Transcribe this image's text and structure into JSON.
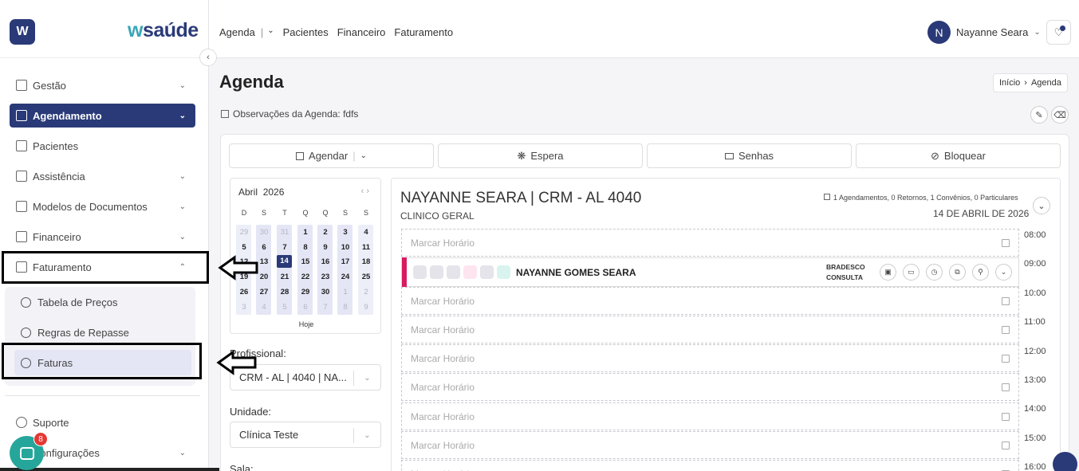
{
  "app": {
    "brand_prefix": "w",
    "brand_rest": "saúde",
    "logo_letter": "W"
  },
  "sidebar": {
    "items": [
      {
        "label": "Gestão"
      },
      {
        "label": "Agendamento"
      },
      {
        "label": "Pacientes"
      },
      {
        "label": "Assistência"
      },
      {
        "label": "Modelos de Documentos"
      },
      {
        "label": "Financeiro"
      },
      {
        "label": "Faturamento"
      }
    ],
    "sub_items": [
      {
        "label": "Tabela de Preços"
      },
      {
        "label": "Regras de Repasse"
      },
      {
        "label": "Faturas"
      }
    ],
    "footer": [
      {
        "label": "Suporte"
      },
      {
        "label": "Configurações"
      }
    ],
    "chat_badge": "8"
  },
  "topnav": {
    "items": [
      "Agenda",
      "Pacientes",
      "Financeiro",
      "Faturamento"
    ],
    "separator": "|"
  },
  "user": {
    "initial": "N",
    "name": "Nayanne Seara"
  },
  "page": {
    "title": "Agenda",
    "breadcrumb": [
      "Início",
      "Agenda"
    ],
    "observations": "Observações da Agenda: fdfs"
  },
  "actions": [
    "Agendar",
    "Espera",
    "Senhas",
    "Bloquear"
  ],
  "calendar": {
    "month": "Abril",
    "year": "2026",
    "weekdays": [
      "D",
      "S",
      "T",
      "Q",
      "Q",
      "S",
      "S"
    ],
    "weeks": [
      [
        "29",
        "30",
        "31",
        "1",
        "2",
        "3",
        "4"
      ],
      [
        "5",
        "6",
        "7",
        "8",
        "9",
        "10",
        "11"
      ],
      [
        "12",
        "13",
        "14",
        "15",
        "16",
        "17",
        "18"
      ],
      [
        "19",
        "20",
        "21",
        "22",
        "23",
        "24",
        "25"
      ],
      [
        "26",
        "27",
        "28",
        "29",
        "30",
        "1",
        "2"
      ],
      [
        "3",
        "4",
        "5",
        "6",
        "7",
        "8",
        "9"
      ]
    ],
    "today_label": "Hoje"
  },
  "filters": {
    "profissional_label": "Profissional:",
    "profissional_value": "CRM - AL | 4040 | NA...",
    "unidade_label": "Unidade:",
    "unidade_value": "Clínica Teste",
    "sala_label": "Sala:"
  },
  "schedule": {
    "doctor": "NAYANNE SEARA | CRM - AL 4040",
    "specialty": "CLINICO GERAL",
    "stats": "1 Agendamentos, 0 Retornos, 1 Convênios, 0 Particulares",
    "date": "14 DE ABRIL DE 2026",
    "empty_slot": "Marcar Horário",
    "appointment": {
      "patient": "NAYANNE GOMES SEARA",
      "insurer": "BRADESCO",
      "type": "CONSULTA"
    },
    "times": [
      "08:00",
      "09:00",
      "10:00",
      "11:00",
      "12:00",
      "13:00",
      "14:00",
      "15:00",
      "16:00"
    ]
  },
  "colors": {
    "primary": "#2a3a78",
    "accent": "#3aa6b9",
    "appointment_bar": "#d81b60",
    "chat": "#26a69a"
  }
}
